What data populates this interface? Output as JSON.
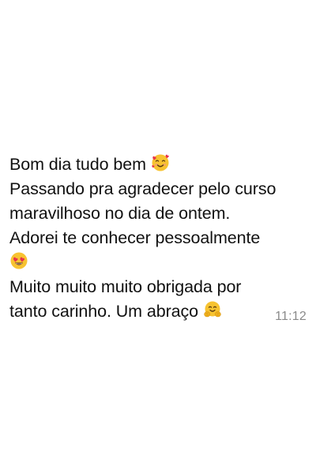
{
  "message": {
    "line1": "Bom dia tudo bem ",
    "line2": "Passando pra agradecer pelo curso",
    "line3": "maravilhoso no dia de ontem.",
    "line4": "Adorei te conhecer pessoalmente",
    "line6": "Muito muito muito obrigada por",
    "line7": "tanto carinho. Um abraço ",
    "emojis": [
      "smiling-face-with-hearts-icon",
      "heart-eyes-icon",
      "hugging-face-icon"
    ]
  },
  "timestamp": "11:12",
  "colors": {
    "background": "#ffffff",
    "text": "#111111",
    "timestamp": "#8a8a8a",
    "emoji_face": "#f7c331",
    "emoji_heart": "#e8334a"
  }
}
